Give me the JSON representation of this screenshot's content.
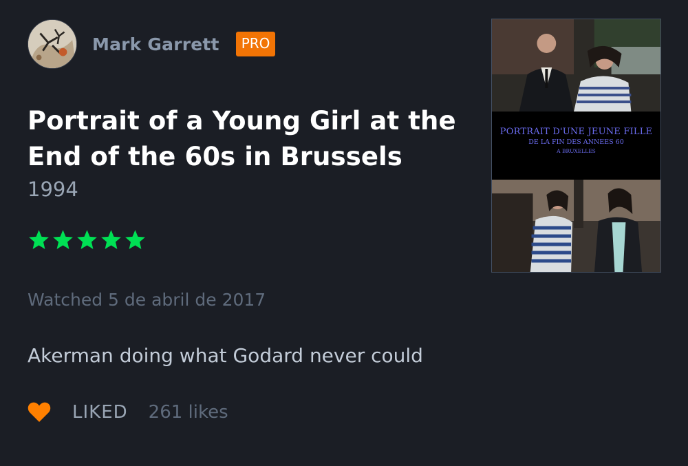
{
  "user": {
    "name": "Mark Garrett",
    "badge": "PRO",
    "avatar_icon": "avatar-image"
  },
  "film": {
    "title": "Portrait of a Young Girl at the End of the 60s in Brussels",
    "year": "1994",
    "rating_stars": 5,
    "rating_max": 5,
    "poster": {
      "line1": "PORTRAIT D'UNE JEUNE FILLE",
      "line2": "DE LA FIN DES ANNEES 60",
      "line3": "A BRUXELLES"
    }
  },
  "diary": {
    "watched": "Watched 5 de abril de 2017"
  },
  "review": {
    "text": "Akerman doing what Godard never could"
  },
  "footer": {
    "liked_label": "LIKED",
    "likes_count": "261 likes",
    "heart_icon": "heart-icon"
  },
  "colors": {
    "background": "#1b1e25",
    "star": "#00e054",
    "pro_badge": "#f27405",
    "heart": "#ff8000",
    "poster_text": "#6b6cf0"
  }
}
